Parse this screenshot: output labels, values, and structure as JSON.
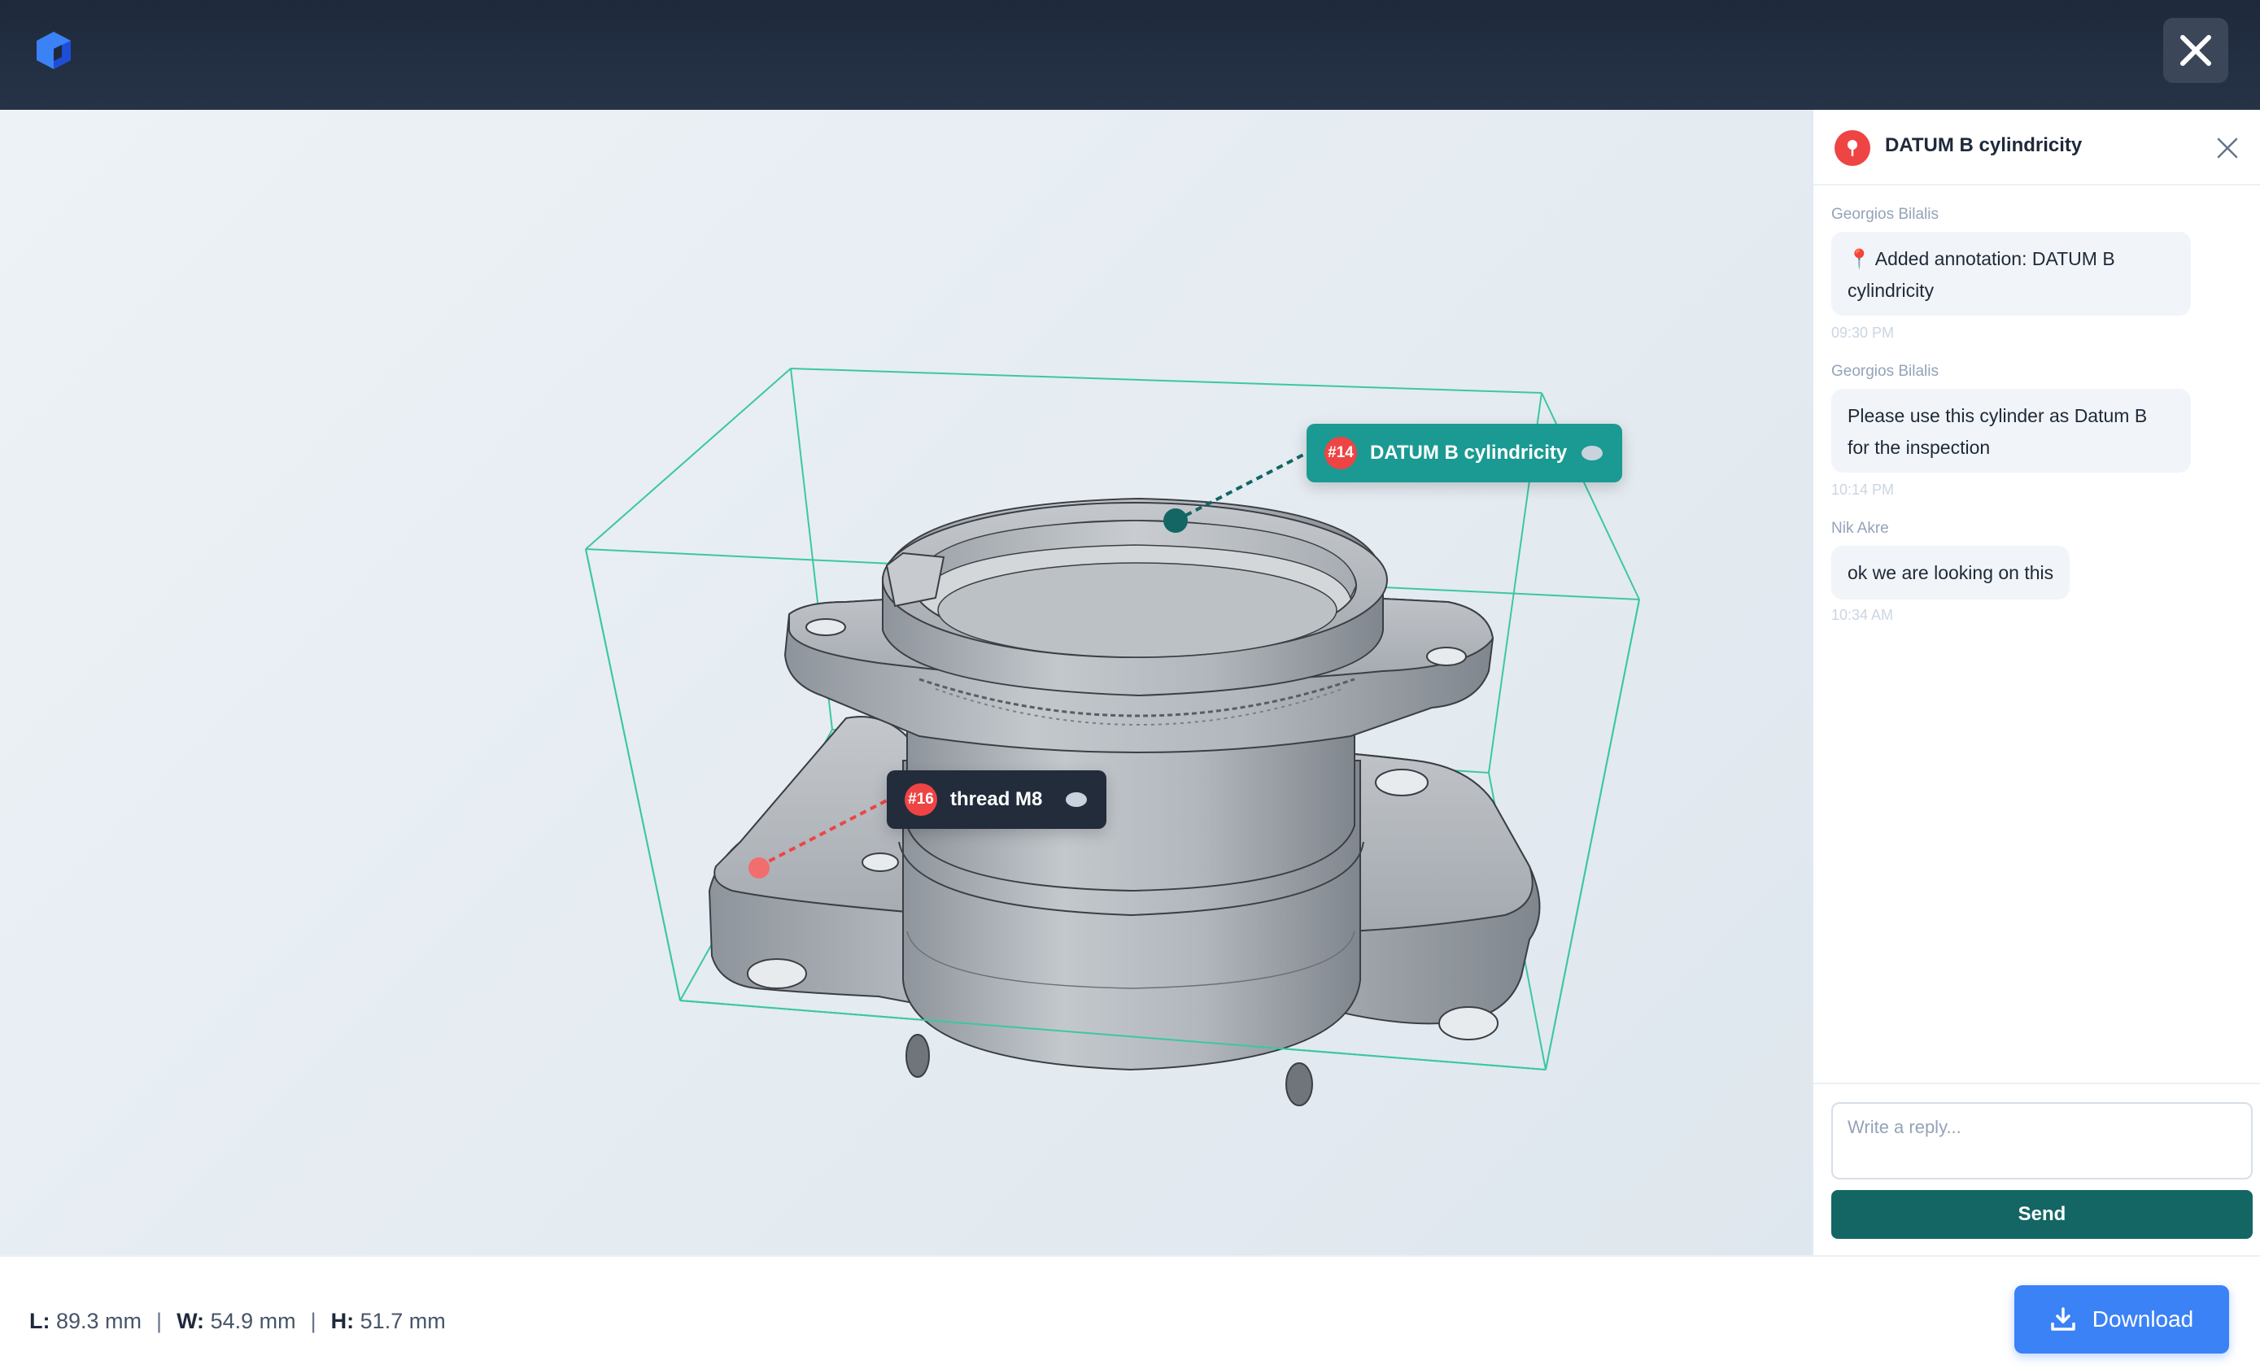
{
  "app": {
    "logo_icon": "cube-logo-icon",
    "close_icon": "close-icon",
    "accent_color": "#3b82f6"
  },
  "annotations": [
    {
      "number": "#14",
      "label": "DATUM B cylindricity",
      "color": "#1a9a92",
      "icon": "comment-icon"
    },
    {
      "number": "#16",
      "label": "thread M8",
      "color": "#222c3b",
      "icon": "comment-icon"
    }
  ],
  "panel": {
    "title": "DATUM B cylindricity",
    "pin_icon": "pin-icon",
    "close_icon": "close-icon",
    "messages": [
      {
        "author": "Georgios Bilalis",
        "text_line1": "📍 Added annotation: DATUM B",
        "text_line2": "cylindricity",
        "time": "09:30 PM"
      },
      {
        "author": "Georgios Bilalis",
        "text_line1": "Please use this cylinder as Datum B",
        "text_line2": "for the inspection",
        "time": "10:14 PM"
      },
      {
        "author": "Nik Akre",
        "text_line1": "ok we are looking on this",
        "time": "10:34 AM"
      }
    ],
    "reply_placeholder": "Write a reply...",
    "send_label": "Send"
  },
  "dimensions": {
    "l_label": "L:",
    "l_value": "89.3 mm",
    "w_label": "W:",
    "w_value": "54.9 mm",
    "h_label": "H:",
    "h_value": "51.7 mm",
    "separator": "|"
  },
  "download": {
    "label": "Download",
    "icon": "download-icon"
  }
}
